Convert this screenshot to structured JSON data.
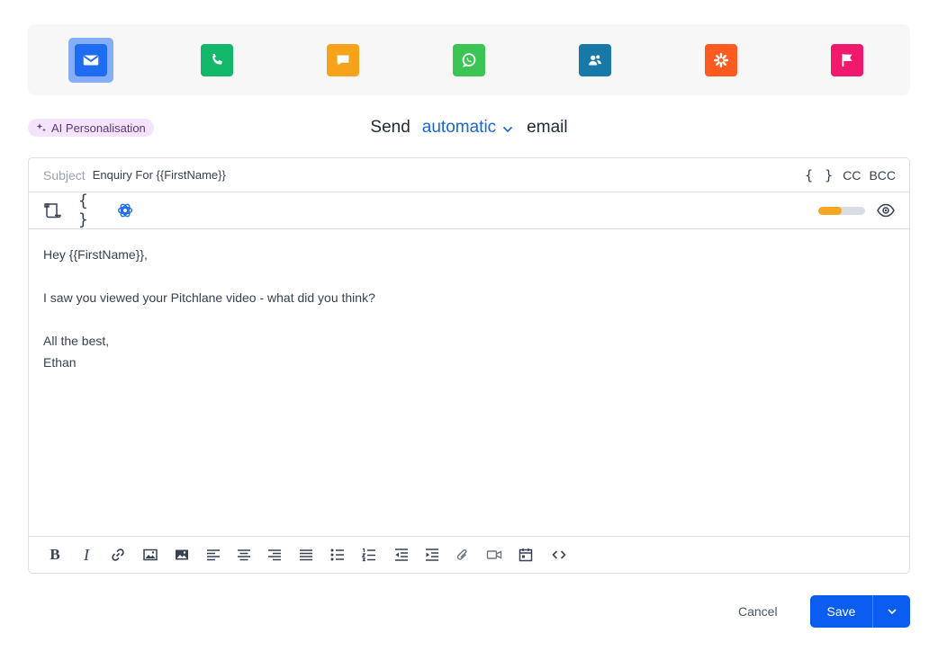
{
  "channels": [
    {
      "name": "email",
      "icon": "envelope-icon",
      "color": "#1e6cf2",
      "active": true
    },
    {
      "name": "call",
      "icon": "phone-icon",
      "color": "#12b76a"
    },
    {
      "name": "sms",
      "icon": "chat-bubble-icon",
      "color": "#f7a21b"
    },
    {
      "name": "whatsapp",
      "icon": "whatsapp-icon",
      "color": "#3cc454"
    },
    {
      "name": "linkedin",
      "icon": "people-icon",
      "color": "#1879a9"
    },
    {
      "name": "zapier",
      "icon": "asterisk-icon",
      "color": "#ff5a1f"
    },
    {
      "name": "task",
      "icon": "flag-icon",
      "color": "#f0196b"
    }
  ],
  "ai_badge": {
    "label": "AI Personalisation"
  },
  "send_line": {
    "prefix": "Send",
    "mode": "automatic",
    "suffix": "email"
  },
  "subject": {
    "label": "Subject",
    "value": "Enquiry For {{FirstName}}"
  },
  "subject_tools": {
    "variables": "{ }",
    "cc": "CC",
    "bcc": "BCC"
  },
  "toolbar": {
    "variables": "{ }",
    "quality_score": 0.5
  },
  "body_lines": [
    "Hey {{FirstName}},",
    "",
    "I saw you viewed your Pitchlane video - what did you think?",
    "",
    "All the best,",
    "Ethan"
  ],
  "format_buttons": [
    "B",
    "I"
  ],
  "footer": {
    "cancel": "Cancel",
    "save": "Save"
  },
  "colors": {
    "accent": "#0b5cf0",
    "link": "#1667d8",
    "progress": "#f5a623",
    "ai_badge_bg": "#f4e3fb"
  }
}
